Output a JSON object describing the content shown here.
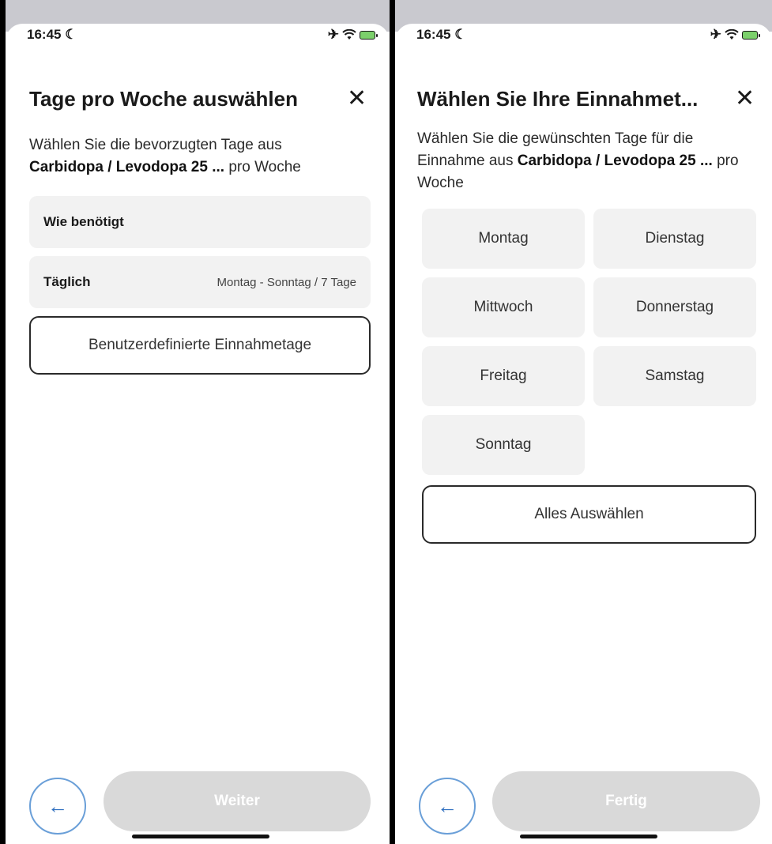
{
  "status_bar": {
    "time": "16:45",
    "moon": "☾",
    "airplane": "✈",
    "wifi": "wifi"
  },
  "screen1": {
    "title": "Tage pro Woche auswählen",
    "close": "✕",
    "desc_prefix": "Wählen Sie die bevorzugten Tage aus",
    "desc_bold": "Carbidopa / Levodopa 25 ...",
    "desc_suffix": " pro Woche",
    "options": [
      {
        "label": "Wie benötigt",
        "sub": ""
      },
      {
        "label": "Täglich",
        "sub": "Montag - Sonntag / 7 Tage"
      }
    ],
    "custom_button": "Benutzerdefinierte Einnahmetage",
    "back": "←",
    "next": "Weiter"
  },
  "screen2": {
    "title": "Wählen Sie Ihre Einnahmet...",
    "close": "✕",
    "desc_prefix": "Wählen Sie die gewünschten Tage für die Einnahme aus ",
    "desc_bold": "Carbidopa / Levodopa 25 ...",
    "desc_suffix": " pro Woche",
    "days": [
      "Montag",
      "Dienstag",
      "Mittwoch",
      "Donnerstag",
      "Freitag",
      "Samstag",
      "Sonntag"
    ],
    "select_all": "Alles Auswählen",
    "back": "←",
    "done": "Fertig"
  }
}
